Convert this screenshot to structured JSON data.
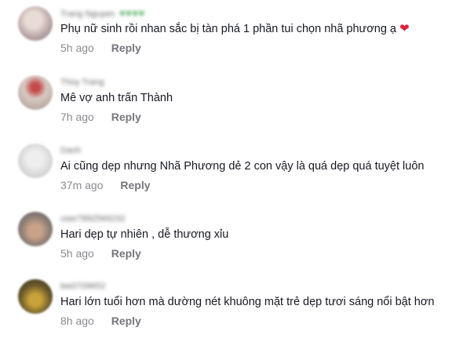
{
  "comments": [
    {
      "username": "Trang Nguyen",
      "username_badge": "♥♥♥♥",
      "text": "Phụ nữ sinh rồi nhan sắc bị tàn phá 1 phần tui chọn nhã phương ạ",
      "emoji": "❤",
      "time": "5h ago",
      "reply": "Reply",
      "avatar_color": "#b9a6a6"
    },
    {
      "username": "Thùy Trang",
      "username_badge": "",
      "text": "Mê vợ anh trấn Thành",
      "emoji": "",
      "time": "7h ago",
      "reply": "Reply",
      "avatar_color": "#c7b3b0"
    },
    {
      "username": "Danh",
      "username_badge": "",
      "text": "Ai cũng dẹp nhưng Nhã Phương dẻ 2 con vậy là quá dẹp quá tuyệt luôn",
      "emoji": "",
      "time": "37m ago",
      "reply": "Reply",
      "avatar_color": "#d9d9db"
    },
    {
      "username": "user7892569232",
      "username_badge": "",
      "text": "Hari dẹp tự nhiên , dễ thương xỉu",
      "emoji": "",
      "time": "5h ago",
      "reply": "Reply",
      "avatar_color": "#8e7f74"
    },
    {
      "username": "lee0709652",
      "username_badge": "",
      "text": "Hari lớn tuổi hơn mà dường nét khuông mặt trẻ dẹp tươi sáng nổi bật hơn",
      "emoji": "",
      "time": "8h ago",
      "reply": "Reply",
      "avatar_color": "#6b5a2c"
    }
  ]
}
